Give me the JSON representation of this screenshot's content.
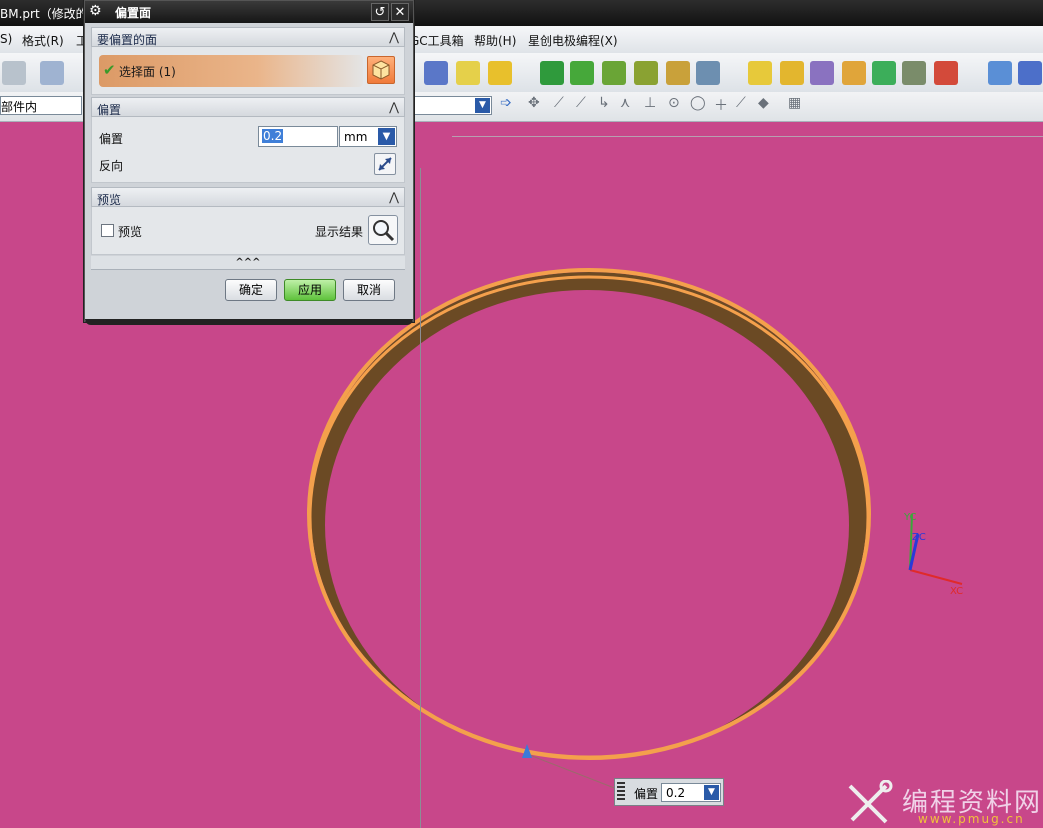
{
  "window": {
    "title": "BM.prt（修改的"
  },
  "menu": {
    "items": [
      "S)",
      "格式(R)",
      "工",
      "GC工具箱",
      "帮助(H)",
      "星创电极编程(X)"
    ]
  },
  "toolbar2": {
    "scope_combo": "部件内"
  },
  "dialog": {
    "title": "偏置面",
    "sections": {
      "face": {
        "header": "要偏置的面",
        "select_label": "选择面 (1)"
      },
      "offset": {
        "header": "偏置",
        "offset_label": "偏置",
        "offset_value": "0.2",
        "unit": "mm",
        "reverse_label": "反向"
      },
      "preview": {
        "header": "预览",
        "preview_label": "预览",
        "show_result_label": "显示结果"
      }
    },
    "expander": "^^^",
    "buttons": {
      "ok": "确定",
      "apply": "应用",
      "cancel": "取消"
    }
  },
  "axes": {
    "x": "XC",
    "y": "YC",
    "z": "ZC"
  },
  "onscreen_input": {
    "label": "偏置",
    "value": "0.2"
  },
  "watermark": {
    "text": "编程资料网",
    "url": "www.pmug.cn"
  },
  "colors": {
    "viewport_bg": "#c8478a",
    "ring": "#f4a04c",
    "ring_inner": "#6b4a24",
    "apply_button": "#5fc23c"
  }
}
